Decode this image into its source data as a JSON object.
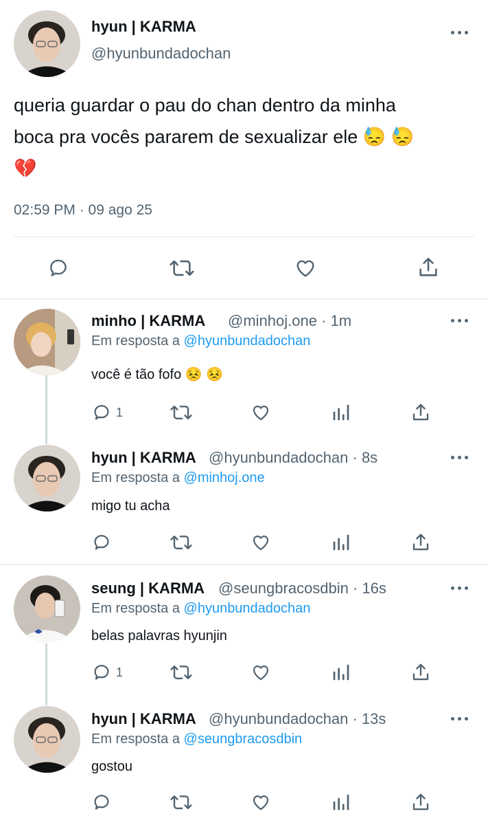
{
  "main_tweet": {
    "author_name": "hyun | KARMA",
    "author_handle": "@hyunbundadochan",
    "text_line1": "queria guardar o pau do chan dentro da minha",
    "text_line2": "boca pra vocês pararem de sexualizar ele 😓 😓",
    "text_line3": "💔",
    "timestamp": "02:59 PM · 09 ago 25"
  },
  "replies": [
    {
      "author_name": "minho | KARMA",
      "author_handle": "@minhoj.one · 1m",
      "reply_prefix": "Em resposta a ",
      "reply_to": "@hyunbundadochan",
      "text": "você é tão fofo 😣 😣",
      "reply_count": "1"
    },
    {
      "author_name": "hyun | KARMA",
      "author_handle": "@hyunbundadochan · 8s",
      "reply_prefix": "Em resposta a ",
      "reply_to": "@minhoj.one",
      "text": "migo tu acha",
      "reply_count": ""
    },
    {
      "author_name": "seung | KARMA",
      "author_handle": "@seungbracosdbin · 16s",
      "reply_prefix": "Em resposta a ",
      "reply_to": "@hyunbundadochan",
      "text": "belas palavras hyunjin",
      "reply_count": "1"
    },
    {
      "author_name": "hyun | KARMA",
      "author_handle": "@hyunbundadochan · 13s",
      "reply_prefix": "Em resposta a ",
      "reply_to": "@seungbracosdbin",
      "text": "gostou",
      "reply_count": ""
    }
  ],
  "icons": {
    "reply": "reply-icon",
    "retweet": "retweet-icon",
    "like": "heart-icon",
    "views": "views-icon",
    "share": "share-icon",
    "more": "more-icon"
  },
  "colors": {
    "link": "#1d9bf0",
    "secondary_text": "#536471",
    "divider": "#e6e9ec"
  }
}
